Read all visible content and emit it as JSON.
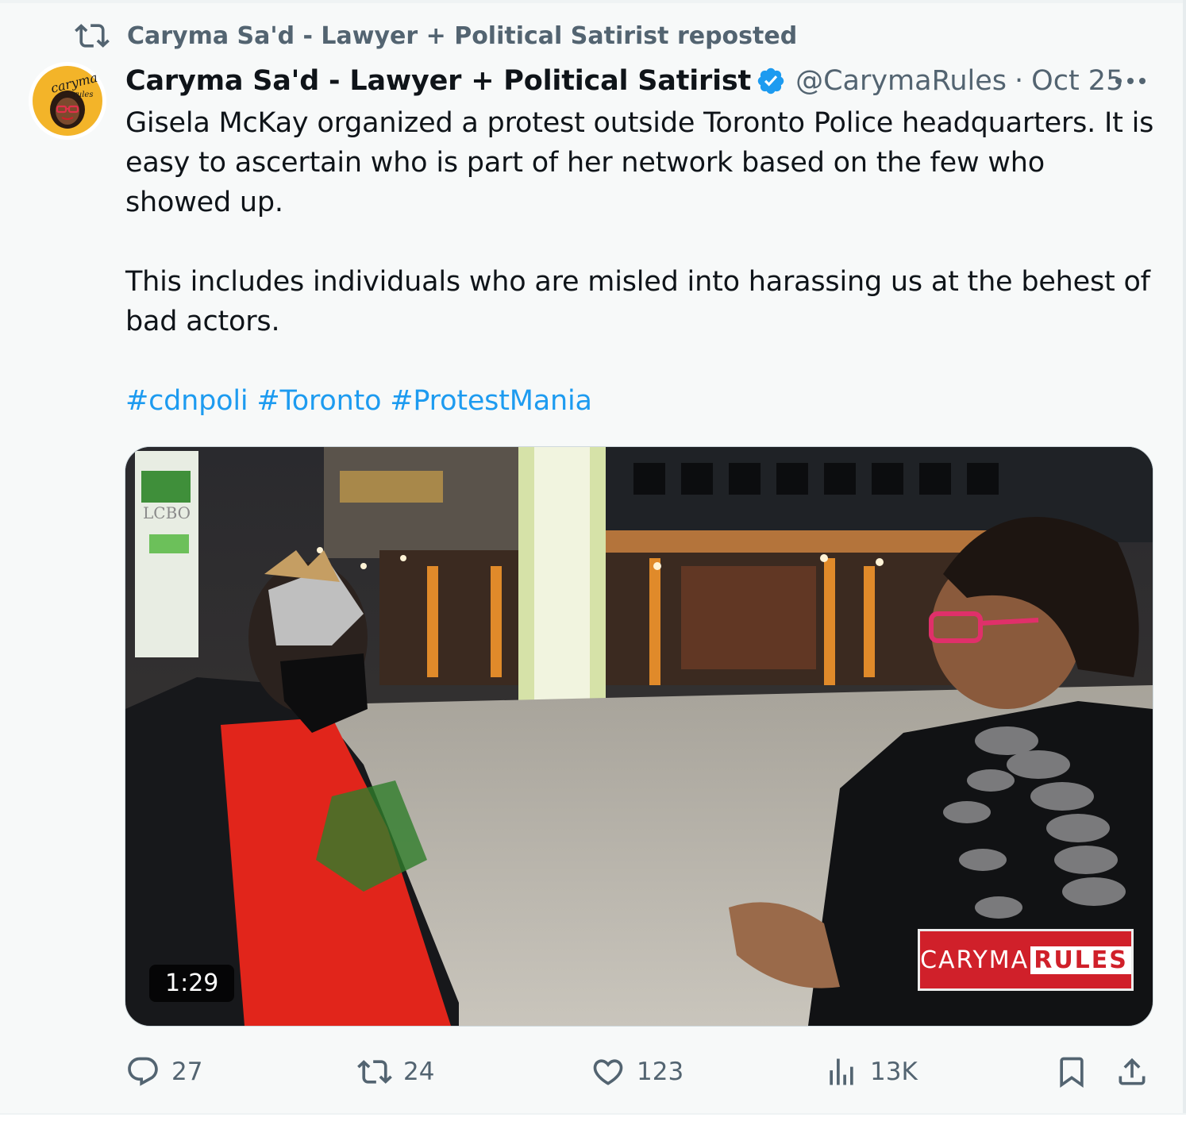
{
  "repost": {
    "label": "Caryma Sa'd - Lawyer + Political Satirist reposted",
    "icon": "repost-icon"
  },
  "tweet": {
    "author_name": "Caryma Sa'd - Lawyer + Political Satirist",
    "verified_icon": "verified-badge-icon",
    "handle": "@CarymaRules",
    "separator": "·",
    "date": "Oct 25",
    "more_icon": "more-options-icon",
    "paragraphs": [
      "Gisela McKay organized a protest outside Toronto Police headquarters. It is easy to ascertain who is part of her network based on the few who showed up.",
      "This includes individuals who are misled into harassing us at the behest of bad actors."
    ],
    "hashtags": [
      "#cdnpoli",
      "#Toronto",
      "#ProtestMania"
    ],
    "avatar": {
      "text_top": "caryma",
      "text_bottom": "rules"
    }
  },
  "media": {
    "duration": "1:29",
    "watermark_left": "CARYMA",
    "watermark_right": "RULES",
    "sign_text": "LCBO"
  },
  "actions": {
    "reply": {
      "icon": "reply-icon",
      "count": "27"
    },
    "repost": {
      "icon": "repost-icon",
      "count": "24"
    },
    "like": {
      "icon": "like-heart-icon",
      "count": "123"
    },
    "views": {
      "icon": "views-bar-chart-icon",
      "count": "13K"
    },
    "bookmark": {
      "icon": "bookmark-icon"
    },
    "share": {
      "icon": "share-icon"
    }
  },
  "colors": {
    "accent": "#1d9bf0",
    "text": "#0f1419",
    "muted": "#536471",
    "background": "#f7f9f9"
  }
}
